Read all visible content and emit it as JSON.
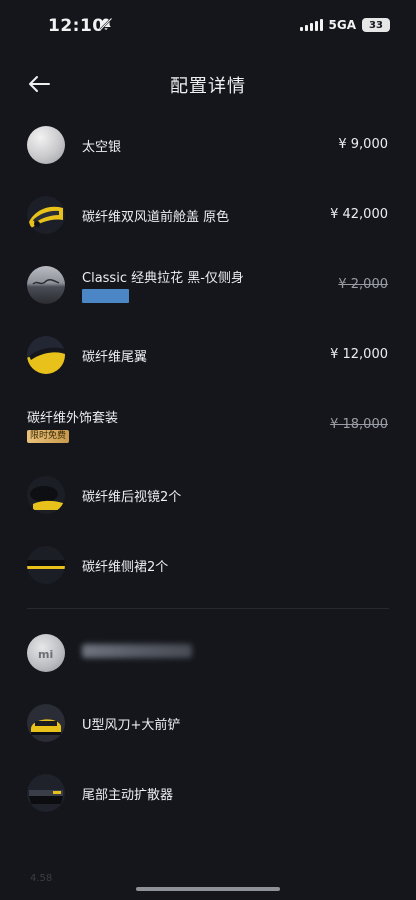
{
  "status_bar": {
    "time": "12:10",
    "network": "5GA",
    "battery": "33"
  },
  "header": {
    "title": "配置详情"
  },
  "items": [
    {
      "name": "太空银",
      "price": "¥ 9,000",
      "thumb": "silver-paint"
    },
    {
      "name": "碳纤维双风道前舱盖 原色",
      "price": "¥ 42,000",
      "thumb": "carbon-hood"
    },
    {
      "name": "Classic 经典拉花 黑-仅侧身",
      "price": "¥ 2,000",
      "price_struck": true,
      "thumb": "classic-livery"
    },
    {
      "name": "碳纤维尾翼",
      "price": "¥ 12,000",
      "thumb": "carbon-wing"
    },
    {
      "name": "碳纤维外饰套装",
      "price": "¥ 18,000",
      "price_struck": true,
      "badge": "限时免费"
    },
    {
      "name": "碳纤维后视镜2个",
      "thumb": "carbon-mirror"
    },
    {
      "name": "碳纤维侧裙2个",
      "thumb": "carbon-side-skirt"
    },
    {
      "thumb": "xiaomi-logo"
    },
    {
      "name": "U型风刀+大前铲",
      "thumb": "front-splitter"
    },
    {
      "name": "尾部主动扩散器",
      "thumb": "rear-diffuser"
    }
  ],
  "footer": {
    "faint_text": "4.58"
  },
  "colors": {
    "background": "#14161b",
    "text": "#eceef2",
    "accent_yellow": "#e8c21a",
    "tag_blue": "#4b86c7",
    "badge_gold": "#e9c27a"
  }
}
